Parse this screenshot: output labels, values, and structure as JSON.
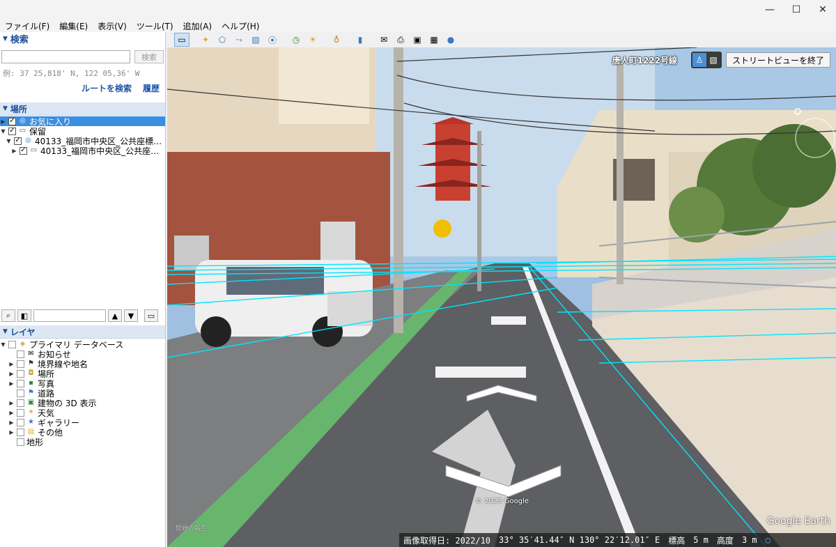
{
  "window": {
    "minimize": "—",
    "maximize": "☐",
    "close": "✕"
  },
  "menu": [
    "ファイル(F)",
    "編集(E)",
    "表示(V)",
    "ツール(T)",
    "追加(A)",
    "ヘルプ(H)"
  ],
  "search": {
    "title": "検索",
    "button": "検索",
    "example": "例: 37 25,818' N, 122 05,36' W",
    "route_link": "ルートを検索",
    "history_link": "履歴"
  },
  "places": {
    "title": "場所",
    "items": [
      {
        "label": "お気に入り",
        "checked": true,
        "selected": true
      },
      {
        "label": "保留",
        "checked": true
      },
      {
        "label": "40133_福岡市中央区_公共座標…",
        "checked": true
      },
      {
        "label": "40133_福岡市中央区_公共座…",
        "checked": true
      }
    ]
  },
  "layers": {
    "title": "レイヤ",
    "items": [
      {
        "label": "プライマリ データベース",
        "icon": "database-icon"
      },
      {
        "label": "お知らせ",
        "icon": "mail-icon"
      },
      {
        "label": "境界線や地名",
        "icon": "flag-icon"
      },
      {
        "label": "場所",
        "icon": "place-icon"
      },
      {
        "label": "写真",
        "icon": "photo-icon"
      },
      {
        "label": "道路",
        "icon": "road-icon"
      },
      {
        "label": "建物の 3D 表示",
        "icon": "building-icon"
      },
      {
        "label": "天気",
        "icon": "sun-icon"
      },
      {
        "label": "ギャラリー",
        "icon": "star-icon"
      },
      {
        "label": "その他",
        "icon": "note-icon"
      },
      {
        "label": "地形",
        "icon": ""
      }
    ]
  },
  "streetview": {
    "street_name": "唐人町1222号線",
    "exit_button": "ストリートビューを終了",
    "copyright": "© 2023 Google",
    "report": "問題の報告",
    "logo": "Google Earth"
  },
  "status": {
    "imagery_date": "画像取得日: 2022/10",
    "coords": "33° 35′41.44″ N 130° 22′12.01″ E",
    "elev_label": "標高",
    "elev_value": "5 m",
    "alt_label": "高度",
    "alt_value": "3 m"
  },
  "colors": {
    "accent": "#1b4f96",
    "selection": "#3c8ee0",
    "overlay_line": "#00e5ff"
  }
}
